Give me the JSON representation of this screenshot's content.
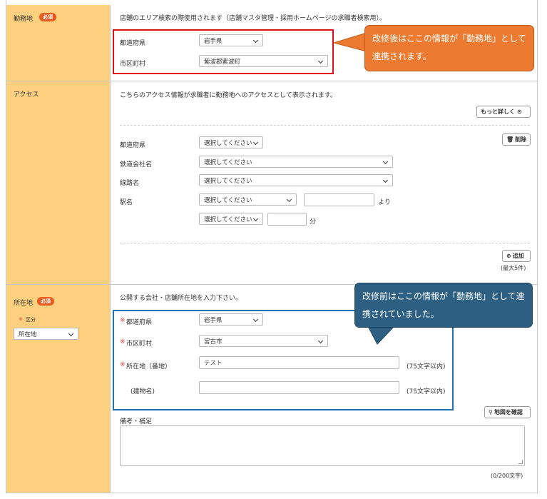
{
  "work_location": {
    "label": "勤務地",
    "badge": "必須",
    "description": "店舗のエリア検索の際使用されます（店舗マスタ管理・採用ホームページの求職者検索用）。",
    "prefecture_label": "都道府県",
    "prefecture_value": "岩手県",
    "city_label": "市区町村",
    "city_value": "紫波郡紫波町"
  },
  "access": {
    "label": "アクセス",
    "description": "こちらのアクセス情報が求職者に勤務地へのアクセスとして表示されます。",
    "more_button": "もっと詳しく",
    "delete_button": "削除",
    "prefecture_label": "都道府県",
    "prefecture_value": "選択してください",
    "railway_label": "鉄道会社名",
    "railway_value": "選択してください",
    "line_label": "線路名",
    "line_value": "選択してください",
    "station_label": "駅名",
    "station_value": "選択してください",
    "from_suffix": "より",
    "method_value": "選択してください",
    "minutes_suffix": "分",
    "add_button": "追加",
    "max_note": "(最大5件)"
  },
  "address": {
    "label": "所在地",
    "badge": "必須",
    "category_label": "区分",
    "category_value": "所在地",
    "description": "公開する会社・店舗所在地を入力下さい。",
    "prefecture_label": "都道府県",
    "prefecture_value": "岩手県",
    "city_label": "市区町村",
    "city_value": "宮古市",
    "street_label": "所在地（番地）",
    "street_value": "テスト",
    "street_limit": "(75文字以内)",
    "building_label": "(建物名)",
    "building_value": "",
    "building_limit": "(75文字以内)",
    "map_button": "地図を確認",
    "remarks_label": "備考・補足",
    "remarks_count": "(0/200文字)"
  },
  "callouts": {
    "after": "改修後はここの情報が「勤務地」として連携されます。",
    "before": "改修前はここの情報が「勤務地」として連携されていました。"
  },
  "colors": {
    "label_bg": "#fdd07f",
    "badge": "#e85a1e",
    "callout_orange": "#ec7a31",
    "callout_blue": "#2d5f82",
    "highlight_red": "#e0101b",
    "highlight_blue": "#1e73b5"
  }
}
